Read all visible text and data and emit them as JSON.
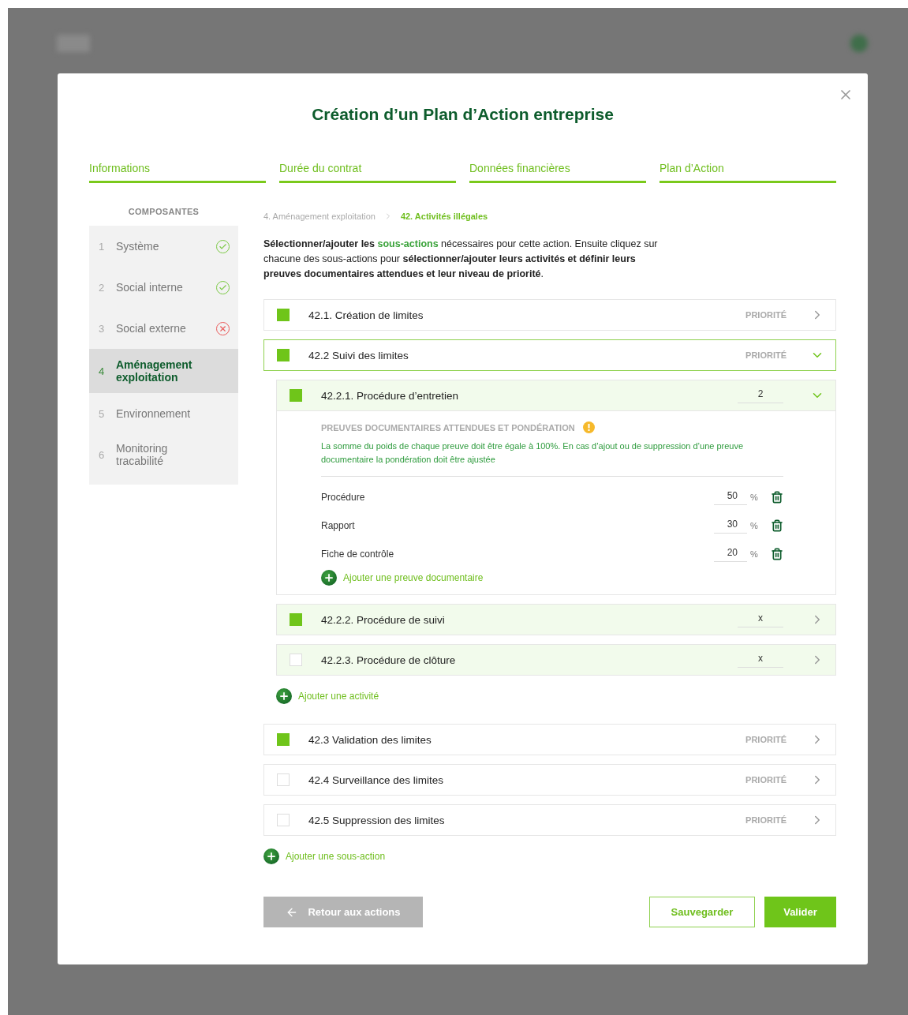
{
  "modal": {
    "title": "Création d’un Plan d’Action entreprise",
    "steps": [
      {
        "label": "Informations"
      },
      {
        "label": "Durée du contrat"
      },
      {
        "label": "Données financières"
      },
      {
        "label": "Plan d’Action"
      }
    ],
    "sidebar": {
      "heading": "COMPOSANTES",
      "items": [
        {
          "number": "1",
          "label": "Système",
          "kind": "done",
          "selected": false
        },
        {
          "number": "2",
          "label": "Social interne",
          "kind": "done",
          "selected": false
        },
        {
          "number": "3",
          "label": "Social externe",
          "kind": "error",
          "selected": false
        },
        {
          "number": "4",
          "label": "Aménagement exploitation",
          "kind": "plain",
          "selected": true
        },
        {
          "number": "5",
          "label": "Environnement",
          "kind": "plain",
          "selected": false
        },
        {
          "number": "6",
          "label": "Monitoring tracabilité",
          "kind": "plain",
          "selected": false
        }
      ]
    },
    "breadcrumb": [
      {
        "label": "4. Aménagement exploitation",
        "selected": false
      },
      {
        "label": "42. Activités illégales",
        "selected": true
      }
    ],
    "intro": [
      {
        "kind": "bold",
        "text": "Sélectionner/ajouter les "
      },
      {
        "kind": "link",
        "text": "sous-actions"
      },
      {
        "kind": "plain",
        "text": " nécessaires pour cette action. Ensuite cliquez sur chacune des sous-actions pour "
      },
      {
        "kind": "bold",
        "text": "sélectionner/ajouter leurs activités et définir leurs preuves documentaires attendues et leur niveau de priorité"
      },
      {
        "kind": "plain",
        "text": "."
      }
    ],
    "sub_actions": [
      {
        "label": "42.1. Création de limites",
        "checked": true,
        "priority": "PRIORITÉ",
        "expanded": false
      },
      {
        "label": "42.2 Suivi des limites",
        "checked": true,
        "priority": "PRIORITÉ",
        "expanded": true,
        "activities": [
          {
            "label": "42.2.1. Procédure d’entretien",
            "checked": true,
            "value": "2",
            "expanded": true,
            "proofs": {
              "heading": "PREUVES DOCUMENTAIRES ATTENDUES ET PONDÉRATION",
              "note": "La somme du poids de chaque preuve doit être égale à 100%. En cas d’ajout ou de suppression d’une preuve documentaire la pondération doit être ajustée",
              "items": [
                {
                  "label": "Procédure",
                  "value": "50",
                  "unit": "%"
                },
                {
                  "label": "Rapport",
                  "value": "30",
                  "unit": "%"
                },
                {
                  "label": "Fiche de contrôle",
                  "value": "20",
                  "unit": "%"
                }
              ],
              "add": "Ajouter une preuve documentaire"
            }
          },
          {
            "label": "42.2.2. Procédure de suivi",
            "checked": true,
            "value": "x",
            "expanded": false
          },
          {
            "label": "42.2.3. Procédure de clôture",
            "checked": false,
            "value": "x",
            "expanded": false
          }
        ],
        "add_activity": "Ajouter une activité"
      },
      {
        "label": "42.3 Validation des limites",
        "checked": true,
        "priority": "PRIORITÉ",
        "expanded": false
      },
      {
        "label": "42.4 Surveillance des limites",
        "checked": false,
        "priority": "PRIORITÉ",
        "expanded": false
      },
      {
        "label": "42.5 Suppression des limites",
        "checked": false,
        "priority": "PRIORITÉ",
        "expanded": false
      }
    ],
    "add_sub_action": "Ajouter une sous-action",
    "buttons": [
      {
        "label": "Retour aux actions",
        "kind": "back"
      },
      {
        "label": "Sauvegarder",
        "kind": "outline"
      },
      {
        "label": "Valider",
        "kind": "primary"
      }
    ]
  }
}
